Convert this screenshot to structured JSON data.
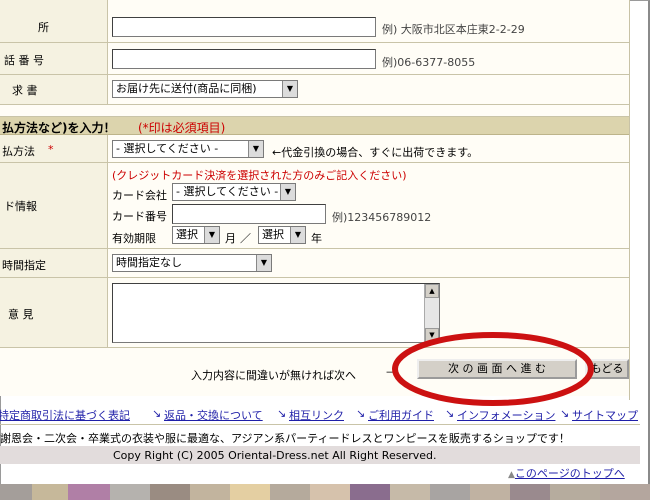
{
  "form": {
    "address_label": "所",
    "address_hint": "例) 大阪市北区本庄東2-2-29",
    "phone_label": "話 番 号",
    "phone_hint": "例)06-6377-8055",
    "invoice_label": "求 書",
    "invoice_select": "お届け先に送付(商品に同梱)",
    "section_title": "払方法など)を入力！",
    "section_required": "(*印は必須項目)",
    "payment_label": "払方法",
    "payment_required_mark": "*",
    "payment_select": "- 選択してください -",
    "payment_note": "←代金引換の場合、すぐに出荷できます。",
    "card_label": "ド情報",
    "card_notice": "(クレジットカード決済を選択された方のみご記入ください)",
    "card_company_label": "カード会社",
    "card_company_select": "- 選択してください -",
    "card_number_label": "カード番号",
    "card_number_hint": "例)123456789012",
    "expiry_label": "有効期限",
    "expiry_month_select": "選択",
    "expiry_month_unit": "月",
    "expiry_separator": "／",
    "expiry_year_select": "選択",
    "expiry_year_unit": "年",
    "time_label": "時間指定",
    "time_select": "時間指定なし",
    "opinion_label": "意 見"
  },
  "actions": {
    "prompt": "入力内容に間違いが無ければ次へ",
    "next_button": "次 の 画 面 へ 進 む",
    "back_button": "もどる"
  },
  "footer": {
    "links": [
      "特定商取引法に基づく表記",
      "返品・交換について",
      "相互リンク",
      "ご利用ガイド",
      "インフォメーション",
      "サイトマップ"
    ],
    "tagline": "謝恩会・二次会・卒業式の衣装や服に最適な、アジアン系パーティードレスとワンピースを販売するショップです！",
    "copyright": "Copy Right (C) 2005 Oriental-Dress.net All Right Reserved.",
    "top_link": "このページのトップへ"
  },
  "colors": {
    "label_bg": "#f5f2e1",
    "section_bg": "#dcd4ad",
    "link": "#1f1fa8",
    "required": "#cc0000",
    "annotation": "#cc1111",
    "footer_band": "#e2dcdc",
    "swatches": [
      "#a49e9a",
      "#c6b89a",
      "#b07fa6",
      "#b5b2ae",
      "#9a8c82",
      "#c2b49e",
      "#e4cfa2",
      "#b5aa9c",
      "#d6c2ac",
      "#8a6d8e",
      "#c6baa8",
      "#a8a4a2",
      "#c0b2a2",
      "#9a8a8e",
      "#b6ac9e",
      "#b4a69e"
    ]
  }
}
